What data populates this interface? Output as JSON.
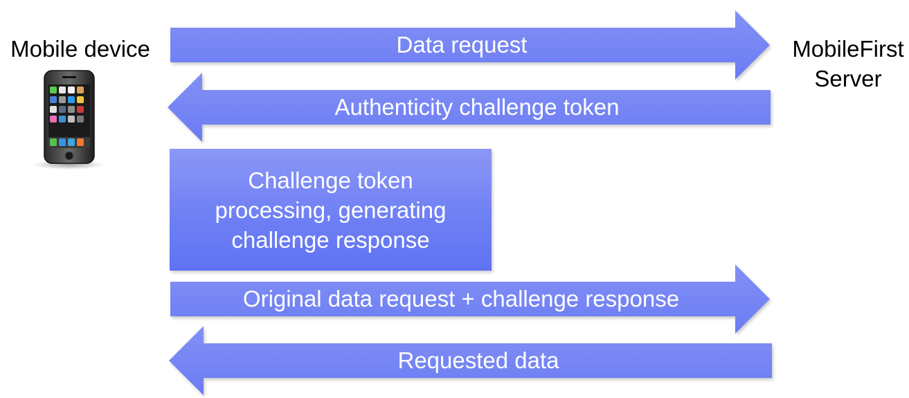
{
  "participants": {
    "device": "Mobile device",
    "server": "MobileFirst\nServer"
  },
  "messages": [
    {
      "label": "Data request",
      "direction": "right"
    },
    {
      "label": "Authenticity challenge token",
      "direction": "left"
    },
    {
      "label": "Original data request + challenge response",
      "direction": "right"
    },
    {
      "label": "Requested data",
      "direction": "left"
    }
  ],
  "process_step": {
    "label": "Challenge token\nprocessing, generating\nchallenge response"
  },
  "colors": {
    "arrow_fill_top": "#8390f5",
    "arrow_fill_bottom": "#6a7cf3",
    "text_on_arrow": "#ffffff"
  },
  "icons": {
    "device": "smartphone-icon"
  }
}
